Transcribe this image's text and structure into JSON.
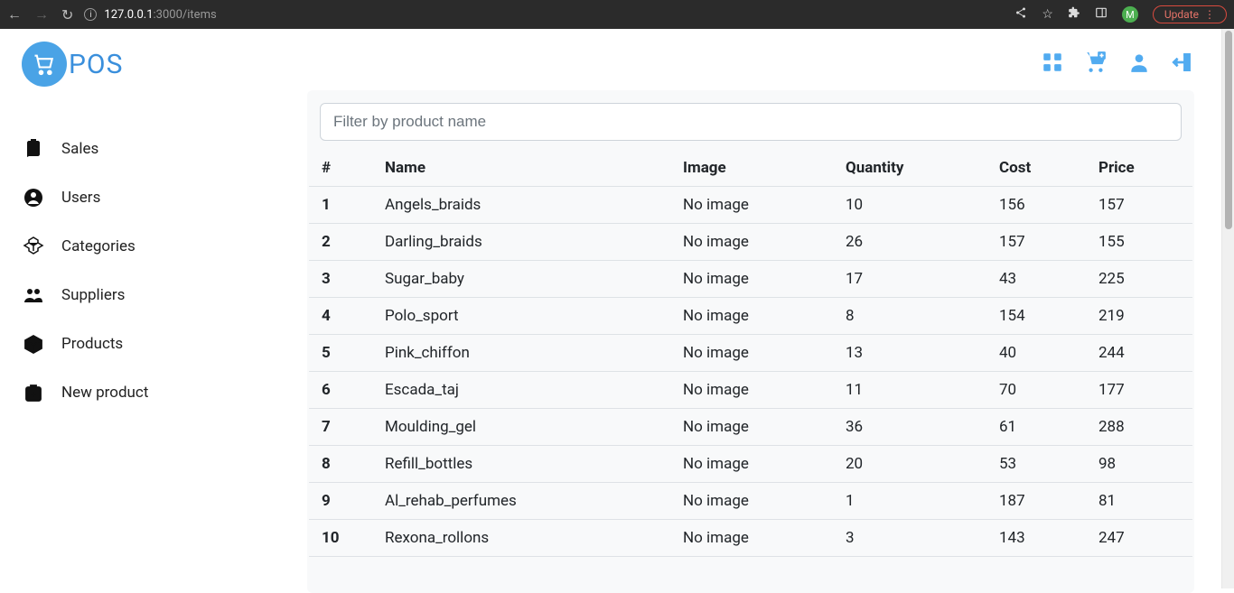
{
  "browser": {
    "url_host": "127.0.0.1",
    "url_path": ":3000/items",
    "update_label": "Update",
    "avatar_letter": "M"
  },
  "logo": {
    "text": "POS"
  },
  "sidebar": {
    "items": [
      {
        "label": "Sales"
      },
      {
        "label": "Users"
      },
      {
        "label": "Categories"
      },
      {
        "label": "Suppliers"
      },
      {
        "label": "Products"
      },
      {
        "label": "New product"
      }
    ]
  },
  "filter": {
    "placeholder": "Filter by product name"
  },
  "table": {
    "headers": {
      "index": "#",
      "name": "Name",
      "image": "Image",
      "quantity": "Quantity",
      "cost": "Cost",
      "price": "Price"
    },
    "no_image_label": "No image",
    "rows": [
      {
        "idx": "1",
        "name": "Angels_braids",
        "quantity": "10",
        "cost": "156",
        "price": "157"
      },
      {
        "idx": "2",
        "name": "Darling_braids",
        "quantity": "26",
        "cost": "157",
        "price": "155"
      },
      {
        "idx": "3",
        "name": "Sugar_baby",
        "quantity": "17",
        "cost": "43",
        "price": "225"
      },
      {
        "idx": "4",
        "name": "Polo_sport",
        "quantity": "8",
        "cost": "154",
        "price": "219"
      },
      {
        "idx": "5",
        "name": "Pink_chiffon",
        "quantity": "13",
        "cost": "40",
        "price": "244"
      },
      {
        "idx": "6",
        "name": "Escada_taj",
        "quantity": "11",
        "cost": "70",
        "price": "177"
      },
      {
        "idx": "7",
        "name": "Moulding_gel",
        "quantity": "36",
        "cost": "61",
        "price": "288"
      },
      {
        "idx": "8",
        "name": "Refill_bottles",
        "quantity": "20",
        "cost": "53",
        "price": "98"
      },
      {
        "idx": "9",
        "name": "Al_rehab_perfumes",
        "quantity": "1",
        "cost": "187",
        "price": "81"
      },
      {
        "idx": "10",
        "name": "Rexona_rollons",
        "quantity": "3",
        "cost": "143",
        "price": "247"
      }
    ]
  }
}
